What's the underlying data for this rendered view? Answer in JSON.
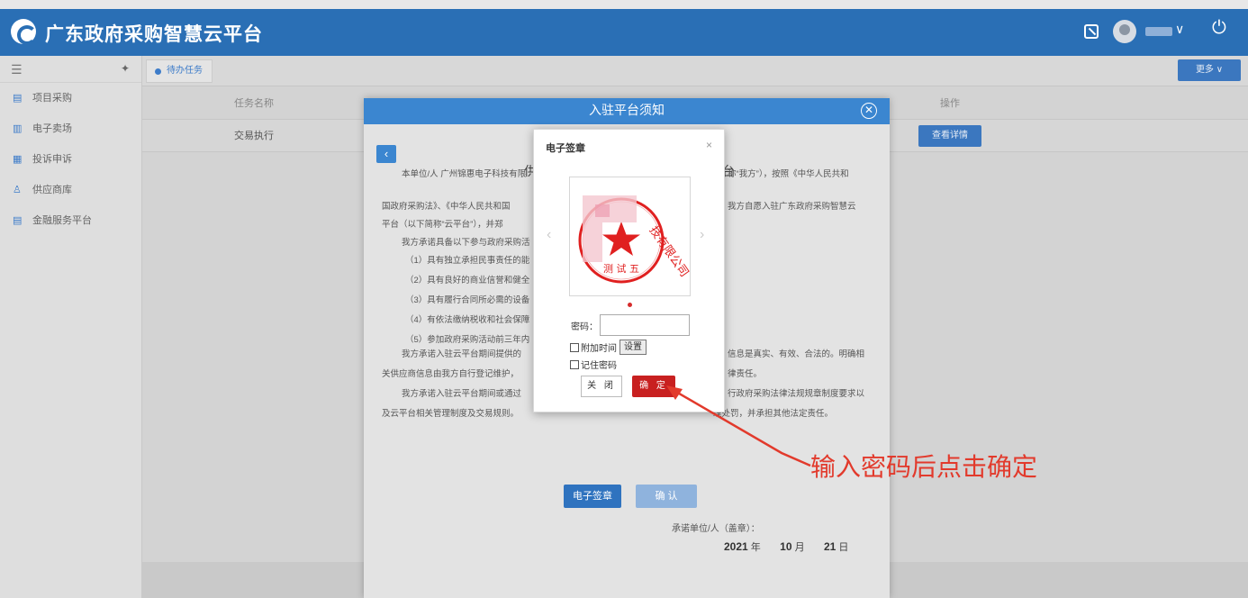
{
  "header": {
    "brand": "广东政府采购智慧云平台",
    "icons": [
      "logo-icon",
      "screen-toggle-icon",
      "user-avatar-icon",
      "chevron-down-icon",
      "power-icon"
    ]
  },
  "sidebar": {
    "items": [
      {
        "label": "项目采购",
        "icon": "procurement-icon"
      },
      {
        "label": "电子卖场",
        "icon": "mall-icon"
      },
      {
        "label": "投诉申诉",
        "icon": "complaint-icon"
      },
      {
        "label": "供应商库",
        "icon": "supplier-icon"
      },
      {
        "label": "金融服务平台",
        "icon": "finance-icon"
      }
    ]
  },
  "main": {
    "tab_label": "待办任务",
    "more_label": "更多 ∨",
    "table": {
      "headers": [
        "任务名称",
        "操作"
      ],
      "rows": [
        {
          "name": "交易执行",
          "action": "查看详情"
        }
      ]
    }
  },
  "dialog": {
    "title": "入驻平台须知",
    "back": "‹",
    "doc_title_left": "供",
    "doc_title_right": "台",
    "paragraphs": [
      "本单位/人 广州锦惠电子科技有限",
      "称“我方”），按照《中华人民共和",
      "国政府采购法》、《中华人民共和国",
      "我方自愿入驻广东政府采购智慧云",
      "平台（以下简称“云平台”），并郑",
      "我方承诺具备以下参与政府采购活",
      "（1）具有独立承担民事责任的能",
      "（2）具有良好的商业信誉和健全",
      "（3）具有履行合同所必需的设备",
      "（4）有依法缴纳税收和社会保障",
      "（5）参加政府采购活动前三年内",
      "我方承诺入驻云平台期间提供的",
      "信息是真实、有效、合法的。明确相",
      "关供应商信息由我方自行登记维护，",
      "律责任。",
      "我方承诺入驻云平台期间或通过",
      "行政府采购法律法规规章制度要求以",
      "及云平台相关管理制度及交易规则。",
      "理处罚，并承担其他法定责任。"
    ],
    "sign_label": "承诺单位/人（盖章）：",
    "year": "2021",
    "year_unit": "年",
    "month": "10",
    "month_unit": "月",
    "day": "21",
    "day_unit": "日",
    "btn_esign": "电子签章",
    "btn_confirm": "确 认"
  },
  "seal_dialog": {
    "title": "电子签章",
    "close_x": "×",
    "stamp_arc": "技有限公司",
    "stamp_name": "测 试 五",
    "pwd_label": "密码：",
    "pwd_value": "",
    "chk_time": "附加时间",
    "set_btn": "设置",
    "chk_remember": "记住密码",
    "close_btn": "关 闭",
    "ok_btn": "确 定"
  },
  "annotation": {
    "text": "输入密码后点击确定",
    "color": "#e23a2c"
  },
  "colors": {
    "header_blue": "#2a6fb5",
    "dialog_blue": "#3b86d0",
    "ok_red": "#c82020"
  }
}
